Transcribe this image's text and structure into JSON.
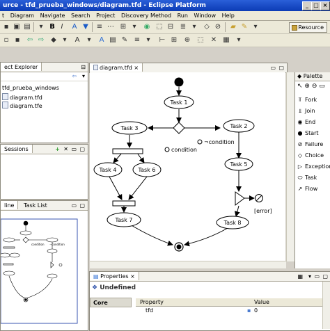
{
  "window": {
    "title": "urce - tfd_prueba_windows/diagram.tfd - Eclipse Platform",
    "min": "_",
    "max": "□",
    "close": "×"
  },
  "menu": [
    "Diagram",
    "Navigate",
    "Search",
    "Project",
    "Discovery Method",
    "Run",
    "Window",
    "Help"
  ],
  "menu_lead": "t",
  "toolbar": {
    "resource_label": "Resource"
  },
  "explorer": {
    "tab": "ect Explorer",
    "items": [
      "tfd_prueba_windows",
      "diagram.tfd",
      "diagram.tfe"
    ]
  },
  "sessions": {
    "tab": "Sessions"
  },
  "outline": {
    "tab1": "line",
    "tab2": "Task List"
  },
  "editor": {
    "tab": "diagram.tfd"
  },
  "diagram": {
    "task1": "Task 1",
    "task2": "Task 2",
    "task3": "Task 3",
    "task4": "Task 4",
    "task5": "Task 5",
    "task6": "Task 6",
    "task7": "Task 7",
    "task8": "Task 8",
    "cond": "condition",
    "notcond": "¬condition",
    "error": "[error]"
  },
  "palette": {
    "title": "Palette",
    "items": [
      "Fork",
      "Join",
      "End",
      "Start",
      "Failure",
      "Choice",
      "Exception",
      "Task",
      "Flow"
    ]
  },
  "properties": {
    "tab": "Properties",
    "heading": "Undefined",
    "section": "Core",
    "col_property": "Property",
    "col_value": "Value",
    "row_property": "tfd",
    "row_value": "0"
  }
}
